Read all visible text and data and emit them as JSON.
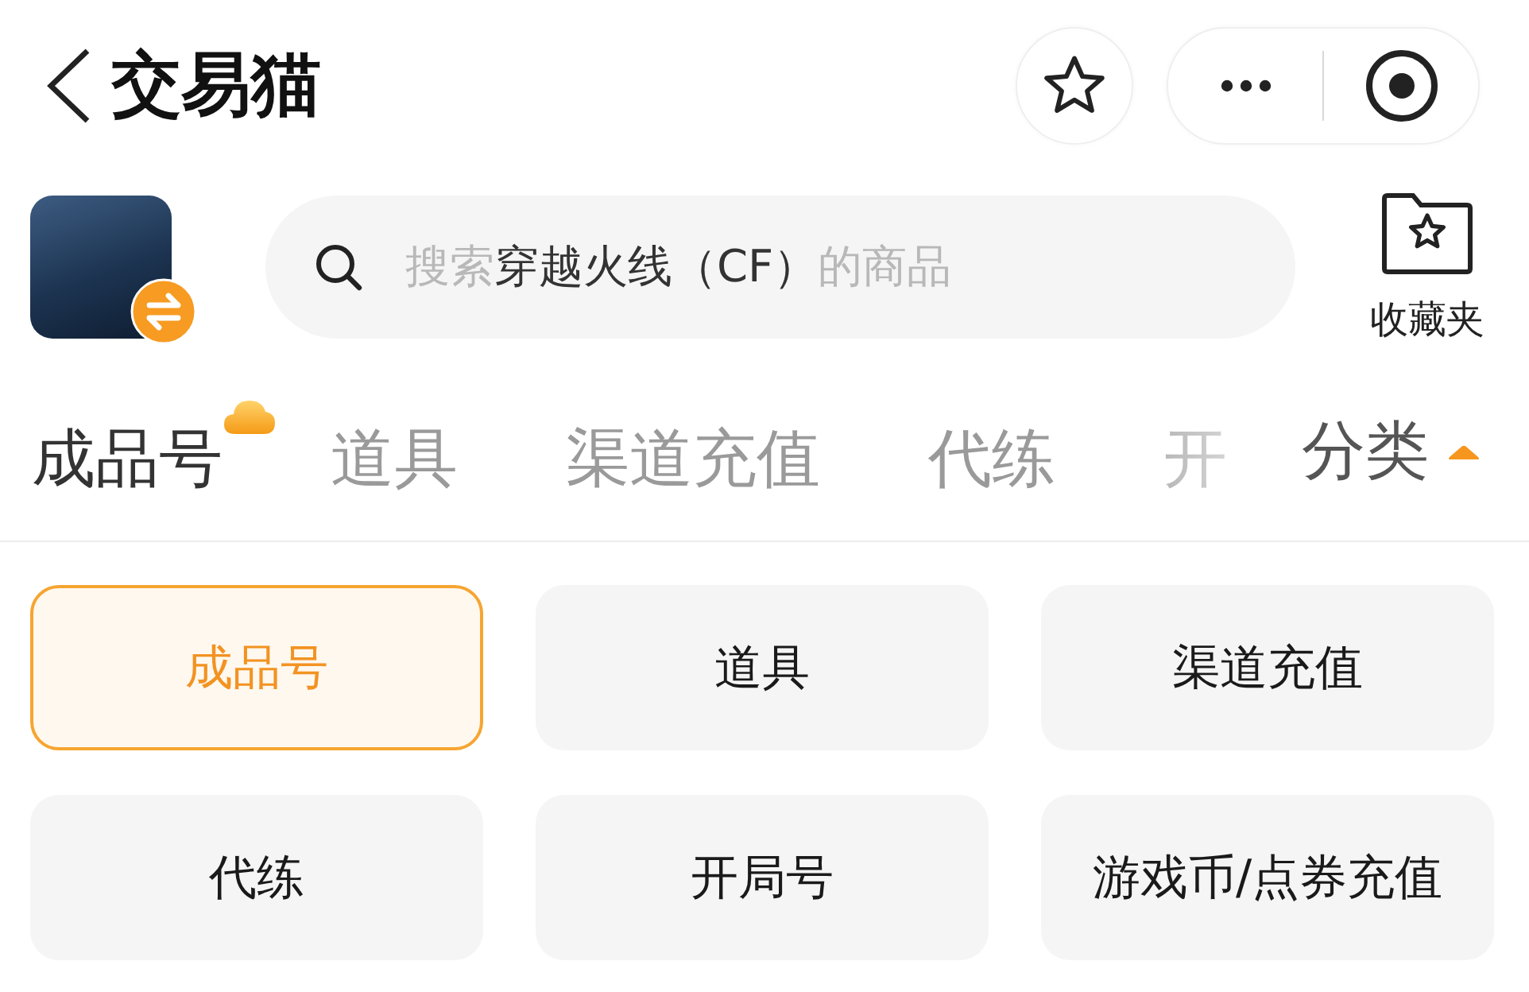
{
  "header": {
    "title": "交易猫"
  },
  "search": {
    "placeholder_prefix": "搜索",
    "keyword": "穿越火线（CF）",
    "placeholder_suffix": "的商品"
  },
  "favorites": {
    "label": "收藏夹"
  },
  "tabs": [
    {
      "label": "成品号",
      "selected": true
    },
    {
      "label": "道具",
      "selected": false
    },
    {
      "label": "渠道充值",
      "selected": false
    },
    {
      "label": "代练",
      "selected": false
    },
    {
      "label": "开",
      "selected": false
    }
  ],
  "category_toggle": {
    "label": "分类",
    "expanded": true
  },
  "categories": [
    {
      "label": "成品号",
      "selected": true
    },
    {
      "label": "道具",
      "selected": false
    },
    {
      "label": "渠道充值",
      "selected": false
    },
    {
      "label": "代练",
      "selected": false
    },
    {
      "label": "开局号",
      "selected": false
    },
    {
      "label": "游戏币/点券充值",
      "selected": false
    }
  ]
}
